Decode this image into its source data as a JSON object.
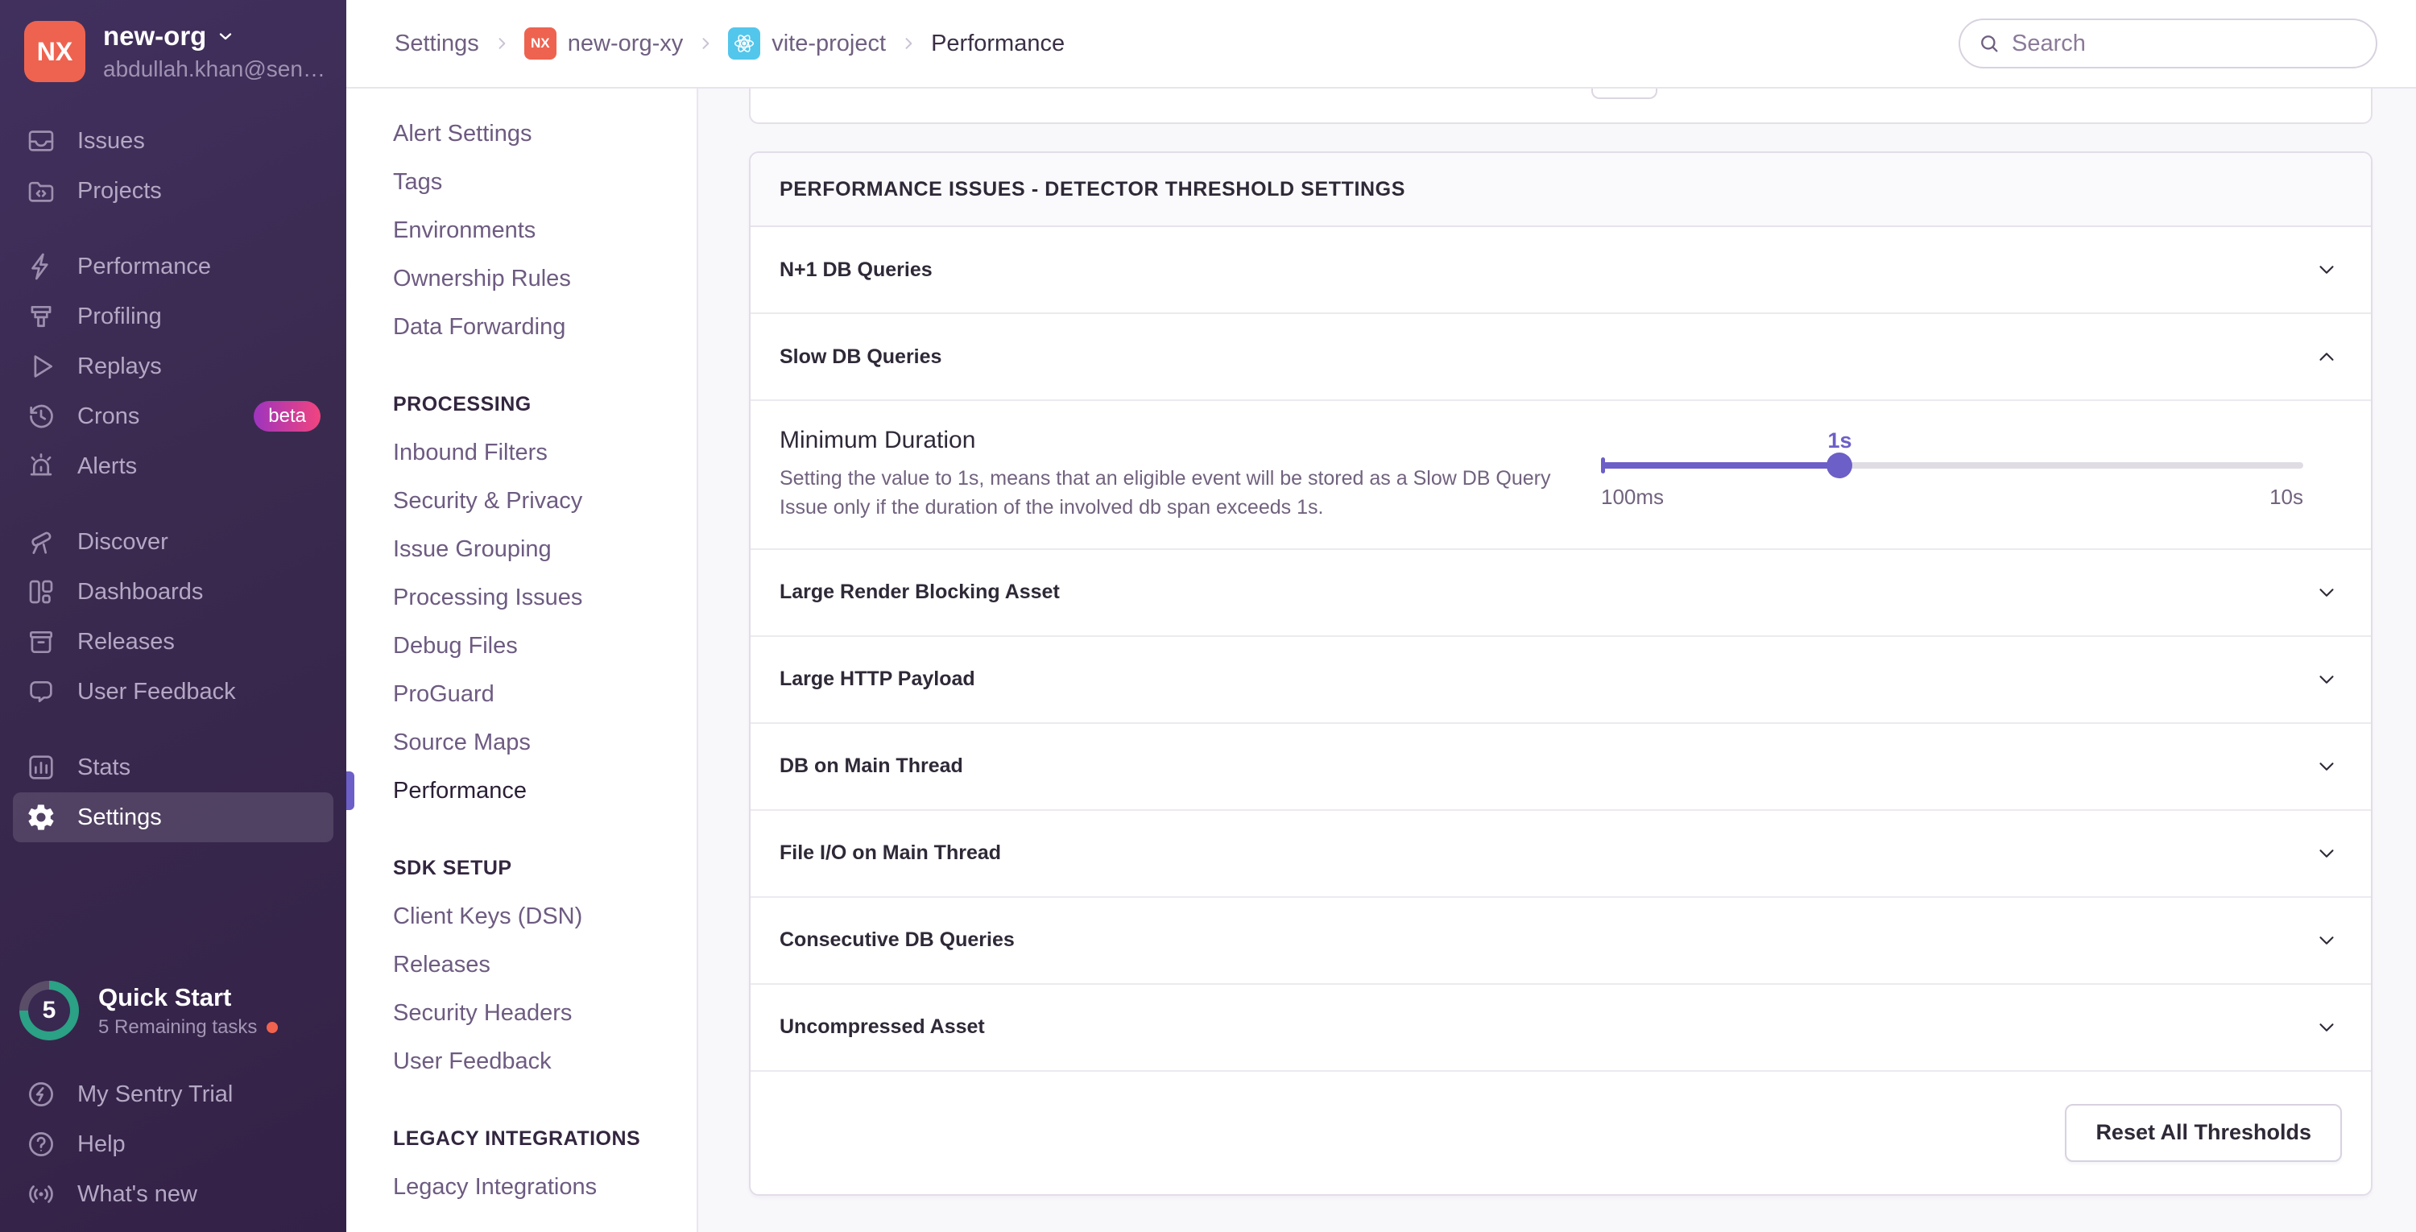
{
  "sidebar": {
    "org": {
      "initials": "NX",
      "name": "new-org",
      "email": "abdullah.khan@sen…"
    },
    "groups": [
      {
        "items": [
          {
            "icon": "issues-icon",
            "label": "Issues"
          },
          {
            "icon": "projects-icon",
            "label": "Projects"
          }
        ]
      },
      {
        "items": [
          {
            "icon": "performance-icon",
            "label": "Performance"
          },
          {
            "icon": "profiling-icon",
            "label": "Profiling"
          },
          {
            "icon": "replays-icon",
            "label": "Replays"
          },
          {
            "icon": "crons-icon",
            "label": "Crons",
            "badge": "beta"
          },
          {
            "icon": "alerts-icon",
            "label": "Alerts"
          }
        ]
      },
      {
        "items": [
          {
            "icon": "discover-icon",
            "label": "Discover"
          },
          {
            "icon": "dashboards-icon",
            "label": "Dashboards"
          },
          {
            "icon": "releases-icon",
            "label": "Releases"
          },
          {
            "icon": "user-feedback-icon",
            "label": "User Feedback"
          }
        ]
      },
      {
        "items": [
          {
            "icon": "stats-icon",
            "label": "Stats"
          },
          {
            "icon": "settings-icon",
            "label": "Settings",
            "active": true
          }
        ]
      }
    ],
    "quickstart": {
      "progress_value": "5",
      "title": "Quick Start",
      "subtitle": "5 Remaining tasks"
    },
    "footer_items": [
      {
        "icon": "trial-icon",
        "label": "My Sentry Trial"
      },
      {
        "icon": "help-icon",
        "label": "Help"
      },
      {
        "icon": "whats-new-icon",
        "label": "What's new"
      }
    ]
  },
  "topbar": {
    "breadcrumb": [
      {
        "label": "Settings"
      },
      {
        "label": "new-org-xy",
        "badge": "nx"
      },
      {
        "label": "vite-project",
        "badge": "react"
      },
      {
        "label": "Performance",
        "current": true
      }
    ],
    "search_placeholder": "Search"
  },
  "settings_nav": {
    "sections": [
      {
        "header": "",
        "items": [
          "Alert Settings",
          "Tags",
          "Environments",
          "Ownership Rules",
          "Data Forwarding"
        ]
      },
      {
        "header": "PROCESSING",
        "items": [
          "Inbound Filters",
          "Security & Privacy",
          "Issue Grouping",
          "Processing Issues",
          "Debug Files",
          "ProGuard",
          "Source Maps",
          "Performance"
        ],
        "active": "Performance"
      },
      {
        "header": "SDK SETUP",
        "items": [
          "Client Keys (DSN)",
          "Releases",
          "Security Headers",
          "User Feedback"
        ]
      },
      {
        "header": "LEGACY INTEGRATIONS",
        "items": [
          "Legacy Integrations"
        ]
      }
    ]
  },
  "main": {
    "panel_title": "PERFORMANCE ISSUES - DETECTOR THRESHOLD SETTINGS",
    "detectors": [
      {
        "label": "N+1 DB Queries",
        "state": "collapsed"
      },
      {
        "label": "Slow DB Queries",
        "state": "expanded"
      },
      {
        "label": "Large Render Blocking Asset",
        "state": "collapsed"
      },
      {
        "label": "Large HTTP Payload",
        "state": "collapsed"
      },
      {
        "label": "DB on Main Thread",
        "state": "collapsed"
      },
      {
        "label": "File I/O on Main Thread",
        "state": "collapsed"
      },
      {
        "label": "Consecutive DB Queries",
        "state": "collapsed"
      },
      {
        "label": "Uncompressed Asset",
        "state": "collapsed"
      }
    ],
    "slow_db_settings": {
      "label": "Minimum Duration",
      "description": "Setting the value to 1s, means that an eligible event will be stored as a Slow DB Query Issue only if the duration of the involved db span exceeds 1s.",
      "slider": {
        "value_label": "1s",
        "min_label": "100ms",
        "max_label": "10s",
        "percent": 34
      }
    },
    "reset_button": "Reset All Thresholds"
  },
  "colors": {
    "accent_purple": "#6C5FC7",
    "avatar_orange": "#EE6350",
    "react_blue": "#53C6EC",
    "progress_teal": "#2BA185",
    "sidebar_bg": "#3A2A4F"
  }
}
